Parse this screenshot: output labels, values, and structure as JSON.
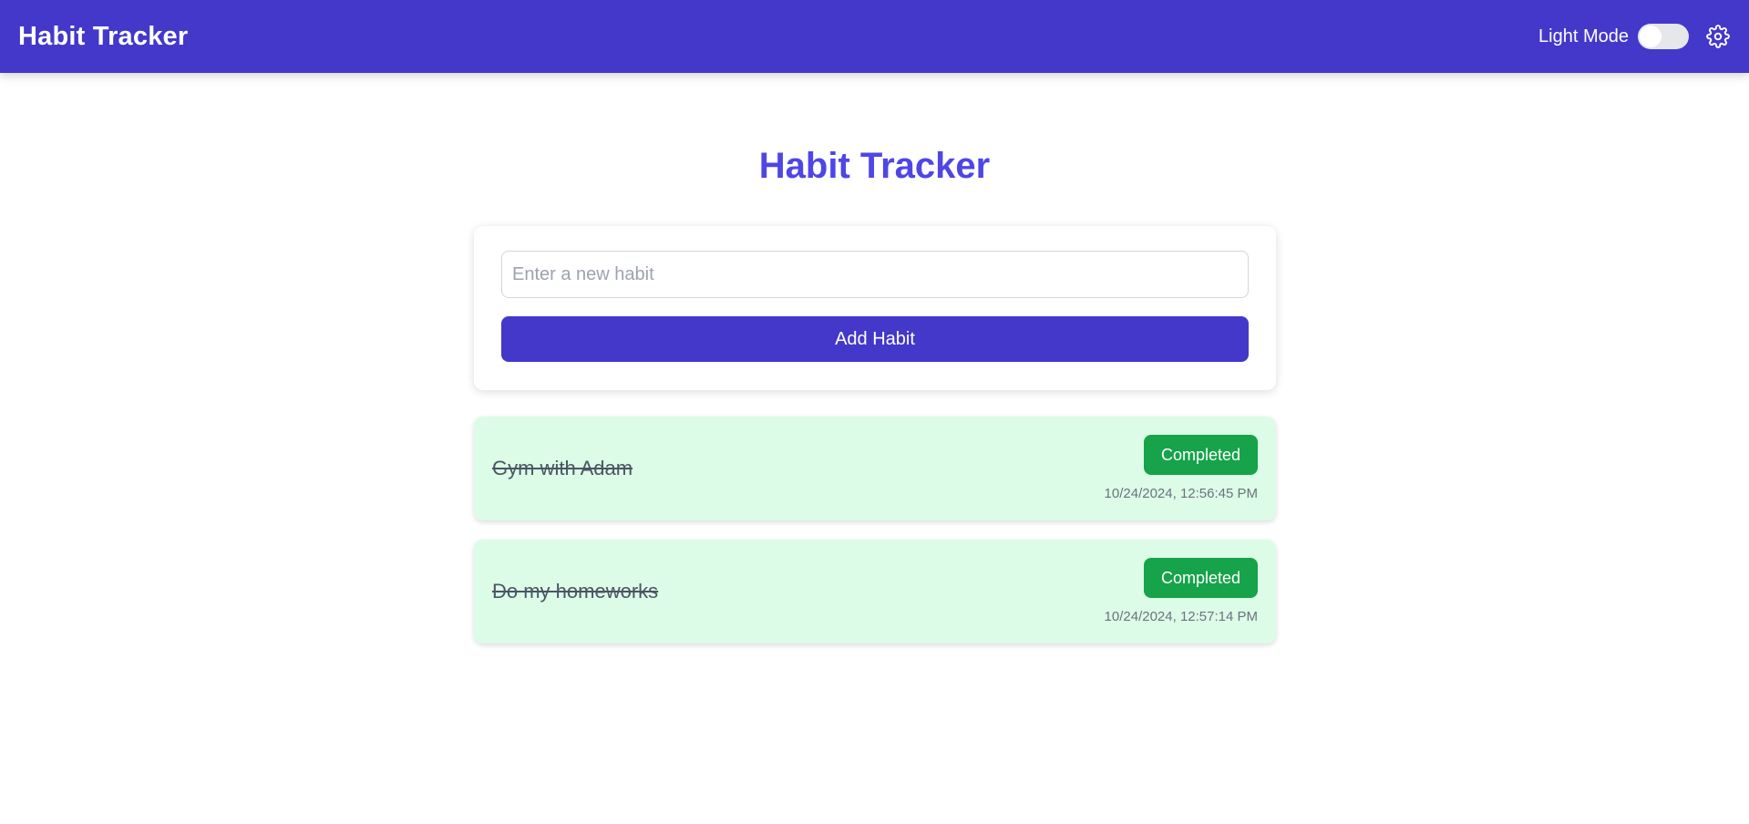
{
  "header": {
    "brand": "Habit Tracker",
    "mode_label": "Light Mode",
    "toggle_icon": "toggle-switch",
    "settings_icon": "gear-icon"
  },
  "main": {
    "title": "Habit Tracker",
    "input_placeholder": "Enter a new habit",
    "input_value": "",
    "add_button_label": "Add Habit"
  },
  "habits": [
    {
      "name": "Gym with Adam",
      "status": "Completed",
      "timestamp": "10/24/2024, 12:56:45 PM"
    },
    {
      "name": "Do my homeworks",
      "status": "Completed",
      "timestamp": "10/24/2024, 12:57:14 PM"
    }
  ],
  "colors": {
    "primary": "#4338ca",
    "title": "#4f46e5",
    "completed_bg": "#dcfce7",
    "completed_button": "#16a34a"
  }
}
